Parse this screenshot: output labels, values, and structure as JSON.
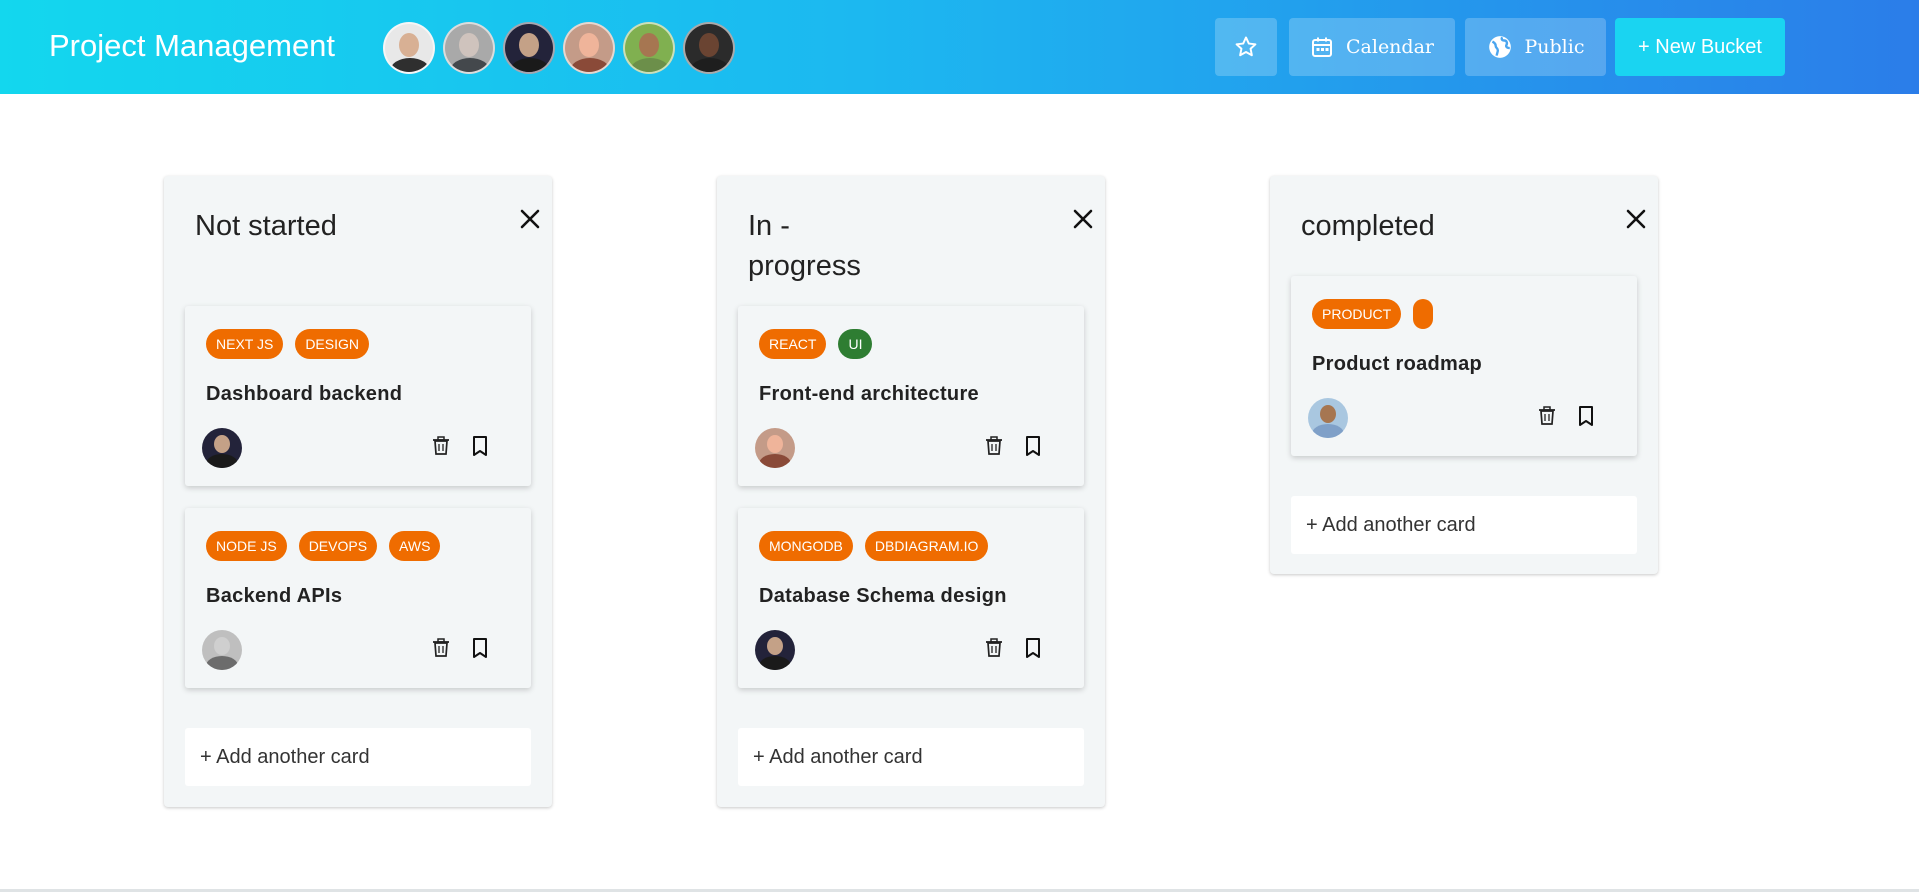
{
  "app": {
    "title": "Project Management",
    "team_avatars": [
      {
        "skin": "#d8b094",
        "shirt": "#2f2f2f",
        "bg": "#e8e8e8"
      },
      {
        "skin": "#cfc3bd",
        "shirt": "#44484c",
        "bg": "#a9a9a9"
      },
      {
        "skin": "#c4a187",
        "shirt": "#1a1a1a",
        "bg": "#23233a"
      },
      {
        "skin": "#efb49a",
        "shirt": "#8a4a38",
        "bg": "#c49b88"
      },
      {
        "skin": "#a67651",
        "shirt": "#6c8f4a",
        "bg": "#80b050"
      },
      {
        "skin": "#6a4432",
        "shirt": "#1e1e1e",
        "bg": "#2b2b2b"
      }
    ]
  },
  "header_buttons": {
    "star_icon": "star-outline-icon",
    "calendar_label": "Calendar",
    "calendar_icon": "calendar-icon",
    "public_label": "Public",
    "public_icon": "globe-icon",
    "new_bucket_label": "+ New Bucket"
  },
  "colors": {
    "tag_orange": "#ef6c00",
    "tag_green": "#2e7d32",
    "bucket_bg": "#f3f6f7",
    "new_bucket_bg": "#1ad4f1"
  },
  "buckets": [
    {
      "title": "Not started",
      "add_card_label": "+ Add another card",
      "cards": [
        {
          "tags": [
            {
              "label": "NEXT JS",
              "color": "#ef6c00"
            },
            {
              "label": "DESIGN",
              "color": "#ef6c00"
            }
          ],
          "title": "Dashboard backend",
          "assignee": {
            "skin": "#c4a187",
            "shirt": "#1a1a1a",
            "bg": "#23233a"
          }
        },
        {
          "tags": [
            {
              "label": "NODE JS",
              "color": "#ef6c00"
            },
            {
              "label": "DEVOPS",
              "color": "#ef6c00"
            },
            {
              "label": "AWS",
              "color": "#ef6c00"
            }
          ],
          "title": "Backend APIs",
          "assignee": {
            "skin": "#cfcfcf",
            "shirt": "#6c6c6c",
            "bg": "#bfbfbf"
          }
        }
      ]
    },
    {
      "title": "In - progress",
      "add_card_label": "+ Add another card",
      "cards": [
        {
          "tags": [
            {
              "label": "REACT",
              "color": "#ef6c00"
            },
            {
              "label": "UI",
              "color": "#2e7d32"
            }
          ],
          "title": "Front-end architecture",
          "assignee": {
            "skin": "#efb49a",
            "shirt": "#8a4a38",
            "bg": "#c49b88"
          }
        },
        {
          "tags": [
            {
              "label": "MONGODB",
              "color": "#ef6c00"
            },
            {
              "label": "DBDIAGRAM.IO",
              "color": "#ef6c00"
            }
          ],
          "title": "Database Schema design",
          "assignee": {
            "skin": "#c4a187",
            "shirt": "#1a1a1a",
            "bg": "#23233a"
          }
        }
      ]
    },
    {
      "title": "completed",
      "add_card_label": "+ Add another card",
      "cards": [
        {
          "tags": [
            {
              "label": "PRODUCT",
              "color": "#ef6c00"
            },
            {
              "label": "",
              "color": "#ef6c00"
            }
          ],
          "title": "Product roadmap",
          "assignee": {
            "skin": "#a67651",
            "shirt": "#7fa0c8",
            "bg": "#a9c7e0"
          }
        }
      ]
    }
  ]
}
